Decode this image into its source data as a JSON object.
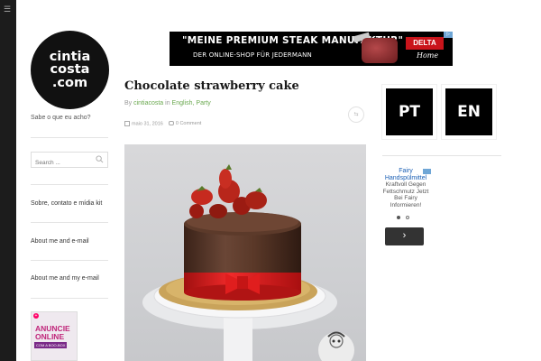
{
  "sidebar": {
    "logo_lines": [
      "cintia",
      "costa",
      ".com"
    ],
    "tagline": "Sabe o que eu acho?",
    "search_placeholder": "Search ...",
    "links": [
      "Sobre, contato e mídia kit",
      "About me and e-mail",
      "About me and my e-mail"
    ],
    "ad": {
      "line1": "ANUNCIE",
      "line2": "ONLINE",
      "line3": "COM A BOO-BOX"
    }
  },
  "banner": {
    "headline": "\"MEINE PREMIUM STEAK MANUFAKTUR\"",
    "subline": "DER ONLINE-SHOP FÜR JEDERMANN",
    "brand": "DELTA",
    "brand_sub": "Home"
  },
  "post": {
    "title": "Chocolate strawberry cake",
    "byline_prefix": "By ",
    "author": "cintiacosta",
    "in_word": " in ",
    "categories": "English, Party",
    "date": "maio 31, 2016",
    "comments": "0 Comment"
  },
  "language": {
    "pt": "PT",
    "en": "EN"
  },
  "right_ad": {
    "title": "Fairy",
    "title2": "Handspülmittel",
    "body1": "Kraftvoll Gegen",
    "body2": "Fettschmutz Jetzt",
    "body3": "Bei Fairy",
    "body4": "Informieren!",
    "next_icon": "chevron-right-icon"
  },
  "colors": {
    "accent": "#6aa84f",
    "dark": "#000000",
    "cake_ribbon": "#e02020"
  }
}
